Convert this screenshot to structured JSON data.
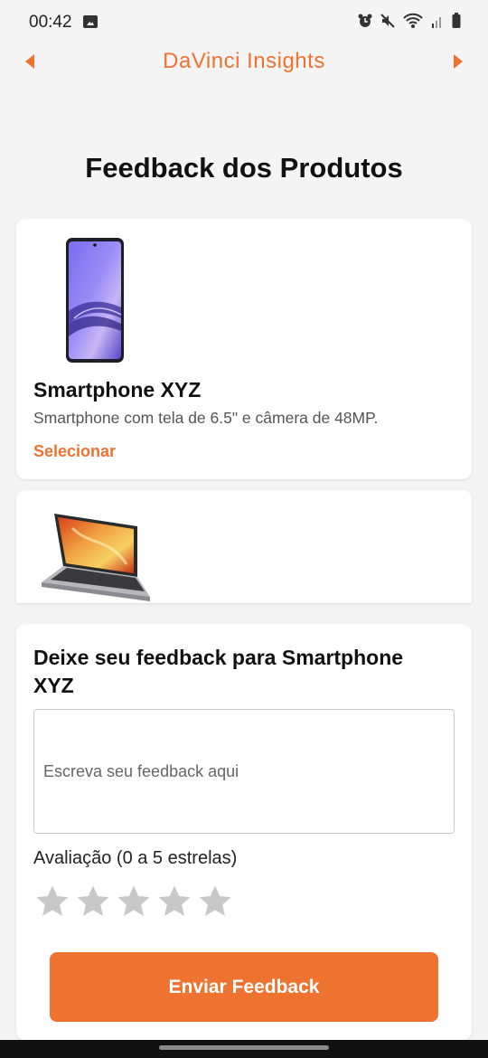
{
  "status_bar": {
    "time": "00:42",
    "icons": [
      "gallery-icon",
      "alarm-icon",
      "mute-icon",
      "wifi-icon",
      "signal-icon",
      "battery-icon"
    ]
  },
  "header": {
    "title": "DaVinci Insights",
    "prev_icon": "caret-left-icon",
    "next_icon": "caret-right-icon"
  },
  "page": {
    "title": "Feedback dos Produtos"
  },
  "products": [
    {
      "name": "Smartphone XYZ",
      "description": "Smartphone com tela de 6.5\" e câmera de 48MP.",
      "select_label": "Selecionar",
      "image": "smartphone-image"
    },
    {
      "image": "laptop-image"
    }
  ],
  "feedback": {
    "heading": "Deixe seu feedback para Smartphone XYZ",
    "placeholder": "Escreva seu feedback aqui",
    "value": "",
    "rating_label": "Avaliação (0 a 5 estrelas)",
    "rating": 0,
    "max_rating": 5,
    "submit_label": "Enviar Feedback"
  },
  "colors": {
    "accent": "#ee7230",
    "background": "#f4f4f4",
    "card": "#ffffff",
    "star_empty": "#c8c8c8"
  }
}
